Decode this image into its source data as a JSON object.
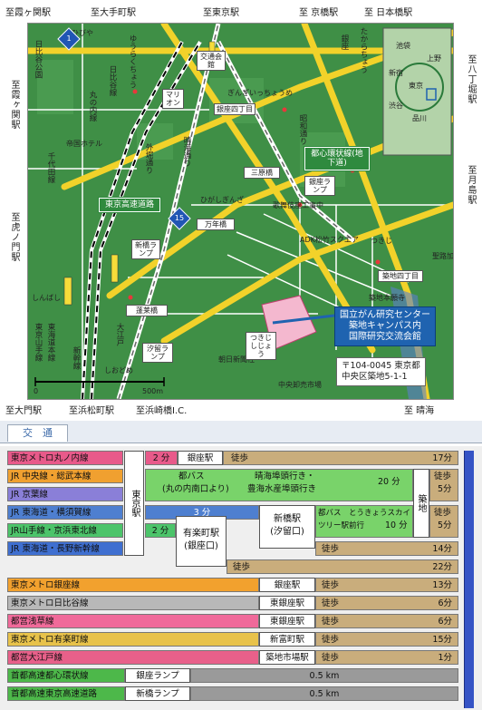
{
  "edges": {
    "top": [
      "至霞ヶ関駅",
      "至大手町駅",
      "至東京駅",
      "至 京橋駅",
      "至 日本橋駅"
    ],
    "left": [
      "至霞ヶ関駅",
      "至虎ノ門駅"
    ],
    "right": [
      "至八丁堀駅",
      "至月島駅"
    ],
    "bottom": [
      "至大門駅",
      "至浜松町駅",
      "至浜崎橋I.C.",
      "至 晴海"
    ]
  },
  "map_labels": {
    "hibiya_park": "日比谷公園",
    "hibiya": "ひびや",
    "yurakucho": "ゆうらくちょう",
    "yurakucho_ln": "有楽町線",
    "kotsu_kaikan": "交通会館",
    "ginza": "銀座",
    "takaracho": "たからちょう",
    "hibiya_ln": "日比谷線",
    "marion": "マリオン",
    "ginza_itchome": "ぎんざいっちょうめ",
    "ginza_yonchome": "銀座四丁目",
    "harumi_dori": "晴海通り",
    "sotobori": "外堀通り",
    "showa_dori": "昭和通り",
    "imperial_hotel": "帝国ホテル",
    "chiyoda_ln": "千代田線",
    "marunouchi_ln": "丸の内線",
    "sanbancho": "三原橋",
    "shuto_loop": "都心環状線(地下道)",
    "ginza_ramp": "銀座ランプ",
    "kabukiza": "歌舞伎座工事中",
    "higashi_ginza": "ひがしぎんざ",
    "mannen": "万年橋",
    "shinbashi_ramp": "新橋ランプ",
    "tokyo_expressway": "東京高速道路",
    "route1": "1",
    "route15": "15",
    "hamazaki": "蓬莱橋",
    "shiodome_ramp": "汐留ランプ",
    "asahi": "朝日新聞社",
    "kachidoki": "勝どき",
    "tsukiji_church": "築地本願寺",
    "tsukiji_yonchome": "築地四丁目",
    "seiroka": "聖路加病院",
    "shintomi": "新富町",
    "adk": "ADK松竹スクエア",
    "tsukiji_shijo": "つきじしじょう",
    "tsukiji": "つきじ",
    "yamanote": "東京山手線",
    "tokaido": "東海道本線",
    "shinkansen": "新幹線",
    "shinbashi": "しんばし",
    "shiodome": "しおどめ",
    "oedo": "大江戸",
    "central_market": "中央卸売市場",
    "scale_0": "0",
    "scale_500": "500m",
    "inset_labels": [
      "池袋",
      "上野",
      "新宿",
      "東京",
      "渋谷",
      "品川"
    ]
  },
  "callout": {
    "line1": "国立がん研究センター",
    "line2": "築地キャンパス内",
    "line3": "国際研究交流会館"
  },
  "address": {
    "line1": "〒104-0045 東京都",
    "line2": "中央区築地5-1-1"
  },
  "tab": "交　通",
  "access": {
    "rows": [
      {
        "line": "東京メトロ丸ノ内線",
        "color": "#e85a8a"
      },
      {
        "line": "JR 中央線・総武本線",
        "color": "#f0a030"
      },
      {
        "line": "JR 京葉線",
        "color": "#8a7fd8"
      },
      {
        "line": "JR 東海道・横須賀線",
        "color": "#4e7fd0"
      },
      {
        "line": "JR山手線・京浜東北線",
        "color": "#4cc46a"
      },
      {
        "line": "JR 東海道・長野新幹線",
        "color": "#3f6fd0"
      },
      {
        "line": "",
        "color": "#e9e9e9"
      },
      {
        "line": "東京メトロ銀座線",
        "color": "#f2a12e"
      },
      {
        "line": "東京メトロ日比谷線",
        "color": "#b8b8b8"
      },
      {
        "line": "都営浅草線",
        "color": "#f06a9a"
      },
      {
        "line": "東京メトロ有楽町線",
        "color": "#e8c24a"
      },
      {
        "line": "都営大江戸線",
        "color": "#e8608a"
      },
      {
        "line": "首都高速都心環状線",
        "color": "#4db84a"
      },
      {
        "line": "首都高速東京高速道路",
        "color": "#4db84a"
      }
    ],
    "tokyo_station": "東京駅",
    "tsukiji_station": "築地",
    "bus1_line1": "都バス",
    "bus1_line2": "(丸の内南口より)",
    "bus1_route1": "晴海埠頭行き・",
    "bus1_route2": "豊海水産埠頭行き",
    "bus1_time": "20 分",
    "bus2_line1": "都バス　とうきょうスカイ",
    "bus2_line2": "ツリー駅前行",
    "bus2_time": "10 分",
    "yurakucho_l1": "有楽町駅",
    "yurakucho_l2": "(銀座口)",
    "shinbashi_l1": "新橋駅",
    "shinbashi_l2": "(汐留口)",
    "t_2min_a": "2 分",
    "t_2min_b": "2 分",
    "t_3min": "3 分",
    "ginza_stn": "銀座駅",
    "walk": "徒歩",
    "t_17": "17分",
    "t_5a": "5分",
    "t_5b": "5分",
    "t_5c": "5分",
    "t_14": "14分",
    "t_22": "22分",
    "t_13": "13分",
    "t_6a": "6分",
    "t_6b": "6分",
    "t_15": "15分",
    "t_1": "1分",
    "ginza_stn2": "銀座駅",
    "higashiginza_stn": "東銀座駅",
    "higashiginza_stn2": "東銀座駅",
    "shintomi_stn": "新富町駅",
    "tsukijishijo_stn": "築地市場駅",
    "ginza_ramp": "銀座ランプ",
    "shinbashi_ramp": "新橋ランプ",
    "km_a": "0.5 km",
    "km_b": "0.5 km"
  },
  "colors": {
    "map_green": "#3f8f46",
    "road_yellow": "#f2d22a",
    "callout_blue": "#1f63b0",
    "walk_tan": "#c9ad7c",
    "bus_green": "#79d36a",
    "hw_gray": "#9a9a9a"
  }
}
